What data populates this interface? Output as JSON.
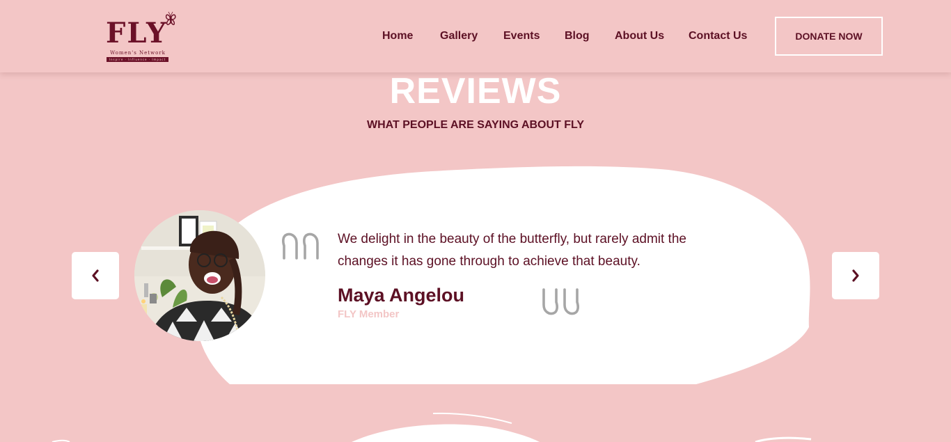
{
  "header": {
    "logo": {
      "wordmark": "FLY",
      "subtitle": "Women's Network",
      "tagline": "Inspire · Influence · Impact"
    },
    "nav": [
      {
        "label": "Home"
      },
      {
        "label": "Gallery"
      },
      {
        "label": "Events"
      },
      {
        "label": "Blog"
      },
      {
        "label": "About Us"
      },
      {
        "label": "Contact Us"
      }
    ],
    "donate_label": "DONATE NOW"
  },
  "reviews": {
    "title": "REVIEWS",
    "subtitle": "WHAT PEOPLE ARE SAYING ABOUT FLY",
    "current": {
      "quote": "We delight in the beauty of the butterfly, but rarely admit the changes it has gone through to achieve that beauty.",
      "author": "Maya Angelou",
      "role": "FLY Member"
    }
  },
  "colors": {
    "background": "#f3c6c6",
    "brand": "#5c1024",
    "card": "#ffffff",
    "quote_mark": "#a6a6a6"
  },
  "icons": {
    "prev": "chevron-left-icon",
    "next": "chevron-right-icon",
    "quote_open": "quote-open-icon",
    "quote_close": "quote-close-icon"
  }
}
